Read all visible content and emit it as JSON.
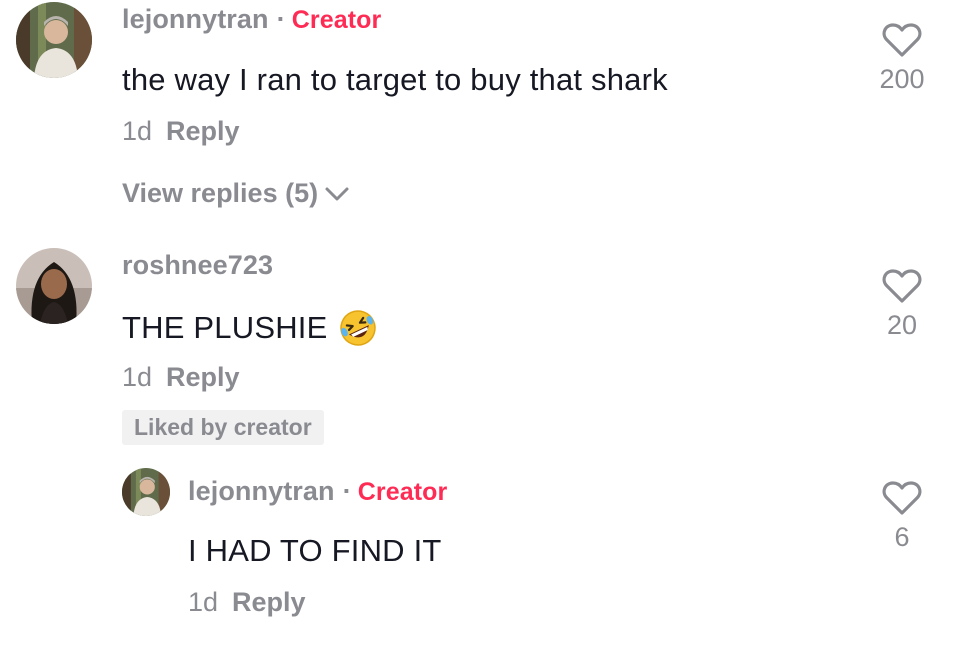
{
  "comments": [
    {
      "username": "lejonnytran",
      "separator": "·",
      "badge": "Creator",
      "text": "the way I ran to target to buy that shark",
      "time": "1d",
      "reply_label": "Reply",
      "likes": "200",
      "view_replies": "View replies (5)"
    },
    {
      "username": "roshnee723",
      "text": "THE PLUSHIE",
      "emoji": "rolling-on-floor-laughing",
      "time": "1d",
      "reply_label": "Reply",
      "likes": "20",
      "liked_by_creator": "Liked by creator"
    }
  ],
  "replies": [
    {
      "username": "lejonnytran",
      "separator": "·",
      "badge": "Creator",
      "text": "I HAD TO FIND IT",
      "time": "1d",
      "reply_label": "Reply",
      "likes": "6"
    }
  ],
  "colors": {
    "creator_badge": "#fe2c55",
    "secondary_text": "#8a8b91",
    "primary_text": "#161823",
    "badge_background": "#f1f1f2"
  }
}
